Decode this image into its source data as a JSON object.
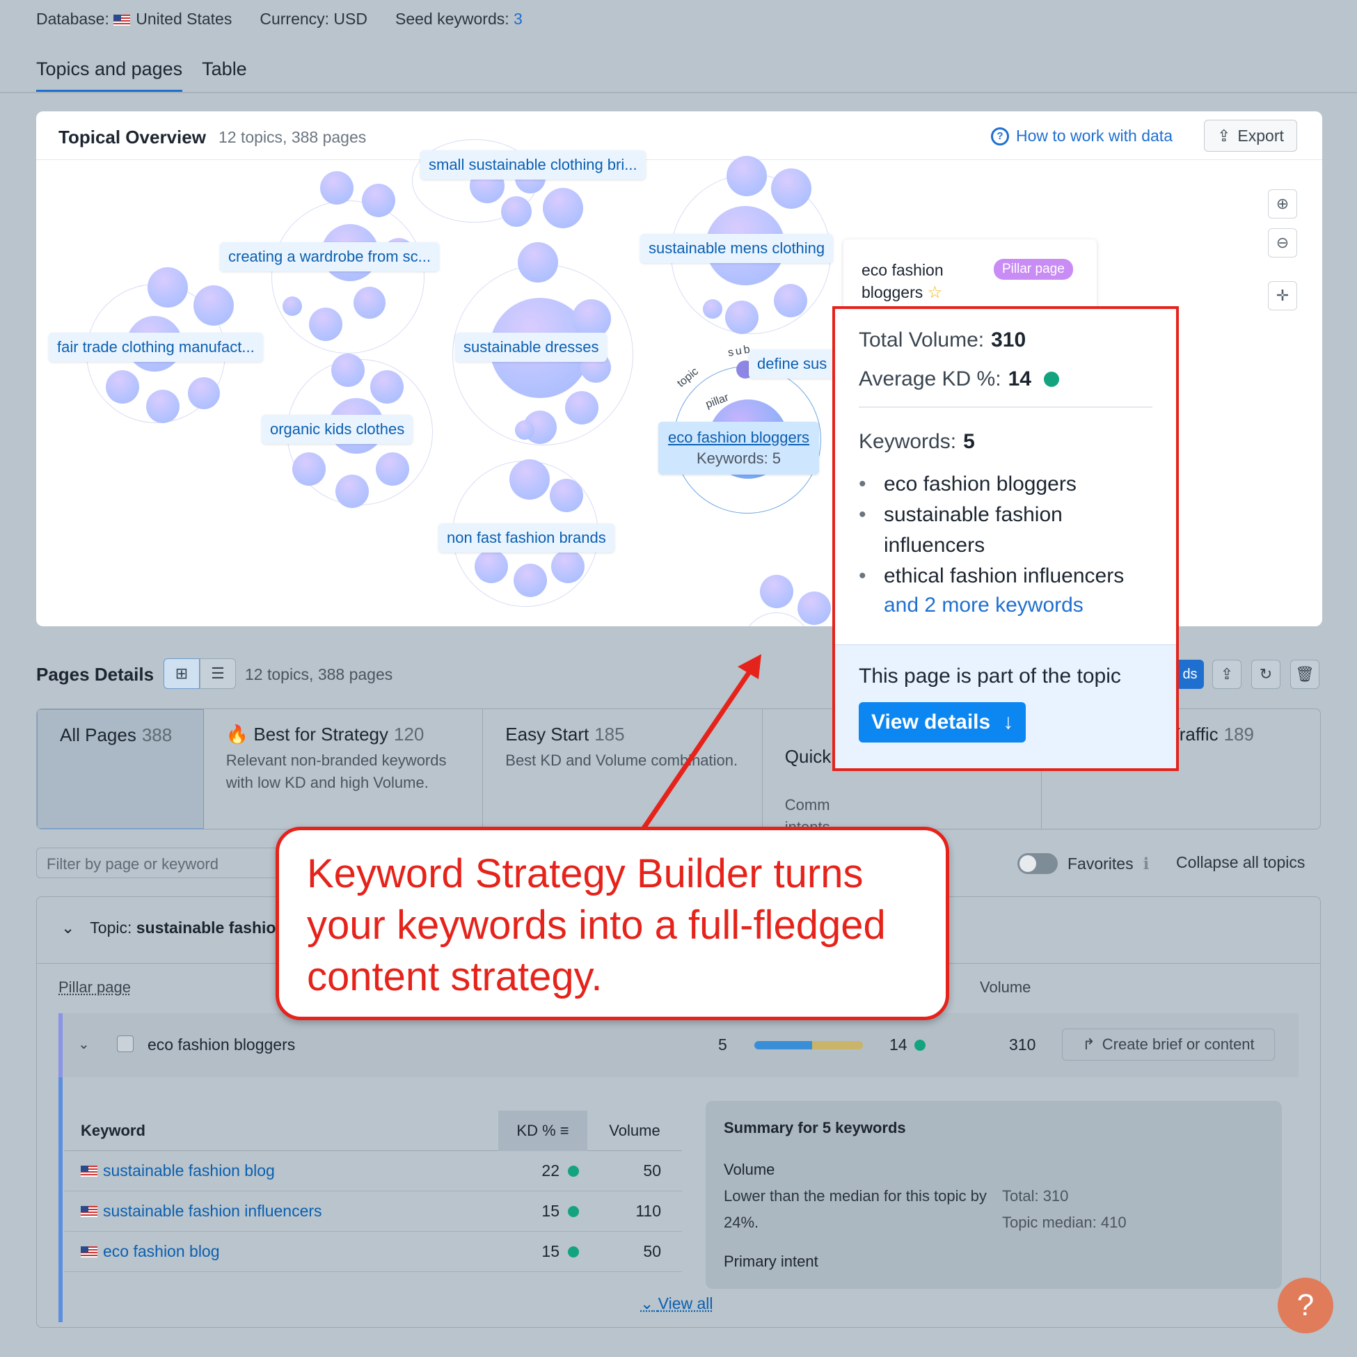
{
  "header": {
    "database_label": "Database:",
    "database_value": "United States",
    "currency": "Currency: USD",
    "seed_label": "Seed keywords:",
    "seed_count": "3"
  },
  "tabs": [
    {
      "label": "Topics and pages",
      "active": true
    },
    {
      "label": "Table",
      "active": false
    }
  ],
  "overview": {
    "title": "Topical Overview",
    "subtitle": "12 topics, 388 pages",
    "how_link": "How to work with data",
    "export_label": "Export",
    "zoom_in_icon": "zoom-in-icon",
    "zoom_out_icon": "zoom-out-icon",
    "center_icon": "center-icon",
    "topics": [
      "small sustainable clothing bri...",
      "creating a wardrobe from sc...",
      "sustainable mens clothing",
      "fair trade clothing manufact...",
      "sustainable dresses",
      "define sus",
      "organic kids clothes",
      "eco fashion bloggers",
      "non fast fashion brands"
    ],
    "selected_keywords": "Keywords: 5",
    "arc_labels": [
      "topic",
      "pillar",
      "sub"
    ]
  },
  "popup": {
    "name": "eco fashion bloggers",
    "badge": "Pillar page",
    "total_volume_label": "Total Volume:",
    "total_volume": "310",
    "avg_kd_label": "Average KD %:",
    "avg_kd": "14",
    "keywords_label": "Keywords:",
    "keywords_count": "5",
    "keywords": [
      "eco fashion bloggers",
      "sustainable fashion influencers",
      "ethical fashion influencers"
    ],
    "more_link": "and 2 more keywords",
    "footer_text": "This page is part of the topic",
    "view_details": "View details"
  },
  "pages": {
    "title": "Pages Details",
    "subtitle": "12 topics, 388 pages",
    "blue_button_partial": "ds",
    "categories": [
      {
        "title": "All Pages",
        "count": "388",
        "desc": ""
      },
      {
        "title": "Best for Strategy",
        "count": "120",
        "desc": "Relevant non-branded keywords with low KD and high Volume."
      },
      {
        "title": "Easy Start",
        "count": "185",
        "desc": "Best KD and Volume combination."
      },
      {
        "title": "Quick",
        "count": "",
        "desc": "Comm\nintents."
      },
      {
        "title": "l Traffic",
        "count": "189",
        "desc": "."
      }
    ],
    "filter_placeholder": "Filter by page or keyword",
    "favorites": "Favorites",
    "collapse": "Collapse all topics",
    "topic_label": "Topic:",
    "topic_name": "sustainable fashio",
    "pillar_label": "Pillar page",
    "volume_label": "Volume",
    "pillar_row": {
      "name": "eco fashion bloggers",
      "keywords": "5",
      "kd": "14",
      "volume": "310",
      "brief": "Create brief or content",
      "bar": [
        0.53,
        0.47
      ],
      "bar_colors": [
        "#3a8ed8",
        "#c9b46a"
      ]
    },
    "kw_headers": {
      "keyword": "Keyword",
      "kd": "KD %",
      "volume": "Volume"
    },
    "kw_rows": [
      {
        "keyword": "sustainable fashion blog",
        "kd": "22",
        "volume": "50"
      },
      {
        "keyword": "sustainable fashion influencers",
        "kd": "15",
        "volume": "110"
      },
      {
        "keyword": "eco fashion blog",
        "kd": "15",
        "volume": "50"
      }
    ],
    "summary": {
      "title": "Summary for 5 keywords",
      "volume_title": "Volume",
      "volume_desc": "Lower than the median for this topic by 24%.",
      "total": "Total: 310",
      "median": "Topic median: 410",
      "intent": "Primary intent"
    },
    "view_all": "View all"
  },
  "callout": {
    "text": "Keyword Strategy Builder turns your keywords into a full-fledged content strategy."
  },
  "colors": {
    "accent": "#1f6fd0",
    "annotation_red": "#e5231b",
    "kd_dot": "#14a37f"
  }
}
